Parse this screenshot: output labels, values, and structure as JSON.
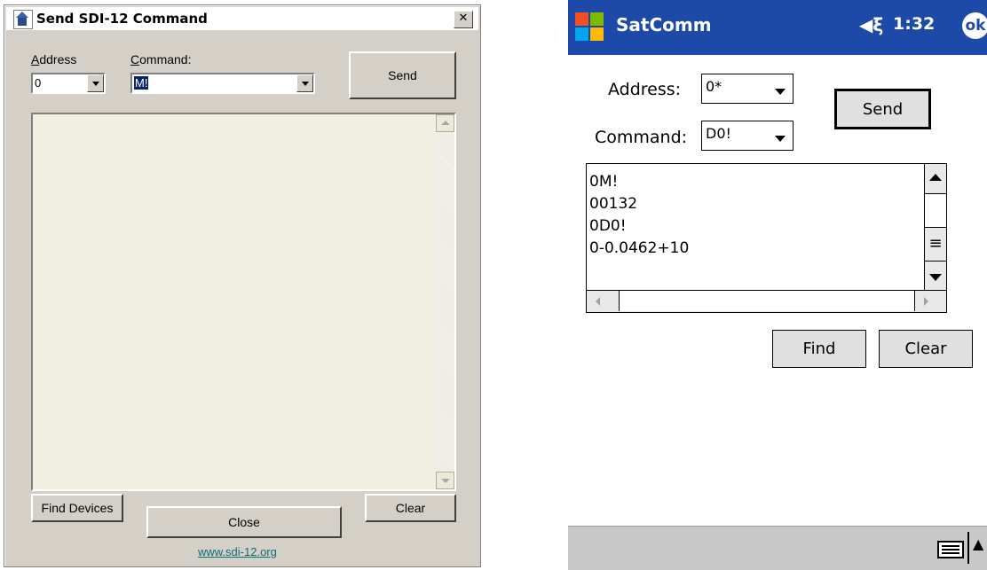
{
  "left_dialog": {
    "title": "Send SDI-12 Command",
    "close_glyph": "✕",
    "address_label": "Address",
    "address_value": "0",
    "command_label": "Command:",
    "command_value": "M!",
    "send_label": "Send",
    "find_devices_label": "Find Devices",
    "close_label": "Close",
    "clear_label": "Clear",
    "link_text": "www.sdi-12.org"
  },
  "right_device": {
    "app_title": "SatComm",
    "volume_glyph": "◀ξ",
    "time": "1:32",
    "ok_label": "ok",
    "address_label": "Address:",
    "address_value": "0*",
    "command_label": "Command:",
    "command_value": "D0!",
    "send_label": "Send",
    "log_lines": [
      "0M!",
      "00132",
      "0D0!",
      "0-0.0462+10"
    ],
    "find_label": "Find",
    "clear_label": "Clear",
    "scroll_middle_glyph": "≡",
    "input_toggle_glyph": "▲"
  },
  "colors": {
    "dialog_bg": "#d4d0c8",
    "device_titlebar": "#1d4aa8",
    "link": "#0b6d76"
  },
  "icons": [
    "app-icon",
    "close-icon",
    "windows-flag-icon",
    "volume-icon",
    "ok-icon",
    "keyboard-icon"
  ]
}
